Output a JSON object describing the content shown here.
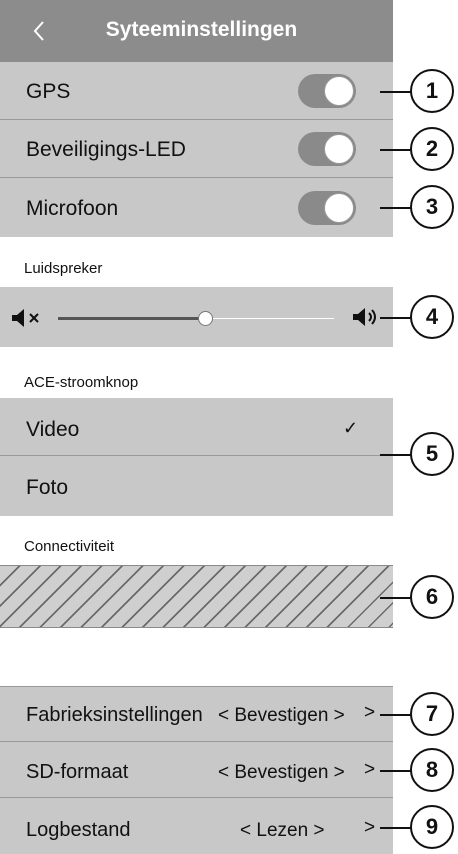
{
  "header": {
    "title": "Syteeminstellingen",
    "back_icon": "chevron-left-icon"
  },
  "toggles": [
    {
      "label": "GPS",
      "on": true
    },
    {
      "label": "Beveiligings-LED",
      "on": true
    },
    {
      "label": "Microfoon",
      "on": true
    }
  ],
  "speaker": {
    "section_label": "Luidspreker",
    "level": 0.52,
    "mute_icon": "speaker-mute-icon",
    "volume_icon": "speaker-volume-icon"
  },
  "power_button": {
    "section_label": "ACE-stroomknop",
    "options": [
      {
        "label": "Video",
        "selected": true
      },
      {
        "label": "Foto",
        "selected": false
      }
    ]
  },
  "connectivity": {
    "section_label": "Connectiviteit"
  },
  "actions": [
    {
      "label": "Fabrieksinstellingen",
      "value": "< Bevestigen >",
      "chevron": ">"
    },
    {
      "label": "SD-formaat",
      "value": "< Bevestigen >",
      "chevron": ">"
    },
    {
      "label": "Logbestand",
      "value": "< Lezen >",
      "chevron": ">"
    }
  ],
  "callouts": [
    "1",
    "2",
    "3",
    "4",
    "5",
    "6",
    "7",
    "8",
    "9"
  ],
  "colors": {
    "header": "#8c8c8c",
    "row": "#c8c8c8",
    "toggle_on": "#8a8a8a"
  }
}
